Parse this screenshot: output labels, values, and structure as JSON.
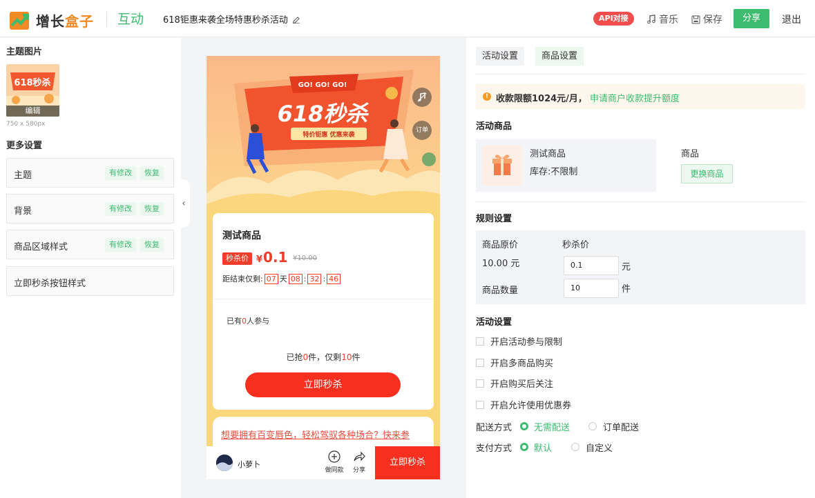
{
  "header": {
    "logo_prefix": "增长",
    "logo_highlight": "盒子",
    "module": "互动",
    "page_title": "618钜惠来袭全场特惠秒杀活动",
    "api_badge": "API对接",
    "music": "音乐",
    "save": "保存",
    "share": "分享",
    "exit": "退出"
  },
  "left": {
    "theme_image_title": "主题图片",
    "thumb_edit": "编辑",
    "thumb_size": "750 x 580px",
    "more_settings_title": "更多设置",
    "items": [
      {
        "label": "主题",
        "modified": "有修改",
        "restore": "恢复"
      },
      {
        "label": "背景",
        "modified": "有修改",
        "restore": "恢复"
      },
      {
        "label": "商品区域样式",
        "modified": "有修改",
        "restore": "恢复"
      },
      {
        "label": "立即秒杀按钮样式"
      }
    ]
  },
  "preview": {
    "banner_top": "GO! GO! GO!",
    "banner_title": "618秒杀",
    "banner_sub": "特价钜惠 优惠来袭",
    "order": "订单",
    "product_name": "测试商品",
    "seckill_tag": "秒杀价",
    "currency": "¥",
    "price": "0.1",
    "original_price": "¥10.00",
    "countdown_label": "距结束仅剩:",
    "cd_days": "07",
    "cd_day_unit": "天",
    "cd_hours": "08",
    "cd_minutes": "32",
    "cd_seconds": "46",
    "joined_pre": "已有",
    "joined_count": "0",
    "joined_post": "人参与",
    "grab_pre": "已抢",
    "grab_count": "0",
    "grab_mid": "件，仅剩",
    "grab_left": "10",
    "grab_post": "件",
    "buy_button": "立即秒杀",
    "promo_link": "想要拥有百变唇色，轻松驾驭各种场合？快来参",
    "user_name": "小萝卜",
    "make_same": "做同款",
    "share": "分享",
    "bottom_buy": "立即秒杀"
  },
  "right": {
    "tabs": [
      "活动设置",
      "商品设置"
    ],
    "notice": "收款限额1024元/月，",
    "notice_link": "申请商户收款提升额度",
    "goods_title": "活动商品",
    "goods_name": "测试商品",
    "goods_stock": "库存:不限制",
    "goods_label": "商品",
    "change_goods": "更换商品",
    "rules_title": "规则设置",
    "orig_price_label": "商品原价",
    "orig_price_value": "10.00 元",
    "seckill_price_label": "秒杀价",
    "seckill_price_value": "0.1",
    "yuan": "元",
    "qty_label": "商品数量",
    "qty_value": "10",
    "jian": "件",
    "activity_title": "活动设置",
    "checkboxes": [
      "开启活动参与限制",
      "开启多商品购买",
      "开启购买后关注",
      "开启允许使用优惠券"
    ],
    "delivery_label": "配送方式",
    "delivery_opt1": "无需配送",
    "delivery_opt2": "订单配送",
    "pay_label": "支付方式",
    "pay_opt1": "默认",
    "pay_opt2": "自定义"
  },
  "colors": {
    "accent_green": "#3dbb6f",
    "accent_red": "#f62f1f",
    "brand_orange": "#f08a24"
  }
}
